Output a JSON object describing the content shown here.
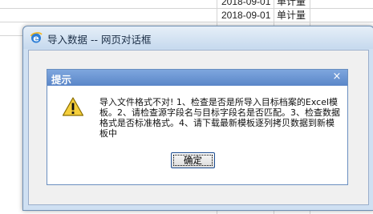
{
  "spreadsheet": {
    "rows": [
      {
        "date": "2018-09-01",
        "unit": "单计量"
      },
      {
        "date": "2018-09-01",
        "unit": "单计量"
      }
    ]
  },
  "window": {
    "title": "导入数据 -- 网页对话框",
    "icon": "ie-icon"
  },
  "dialog": {
    "title": "提示",
    "close_glyph": "×",
    "icon": "warning-icon",
    "message": "导入文件格式不对!  1、检查是否是所导入目标档案的Excel模板。2、请检查源字段名与目标字段名是否匹配。3、检查数据格式是否标准格式。4、请下载最新模板逐列拷贝数据到新模板中",
    "ok_label": "确定"
  },
  "colors": {
    "dialog_title_bar": "#6b95d4",
    "window_frame": "#cfe0f2",
    "warning_fill": "#f5cf3c"
  }
}
